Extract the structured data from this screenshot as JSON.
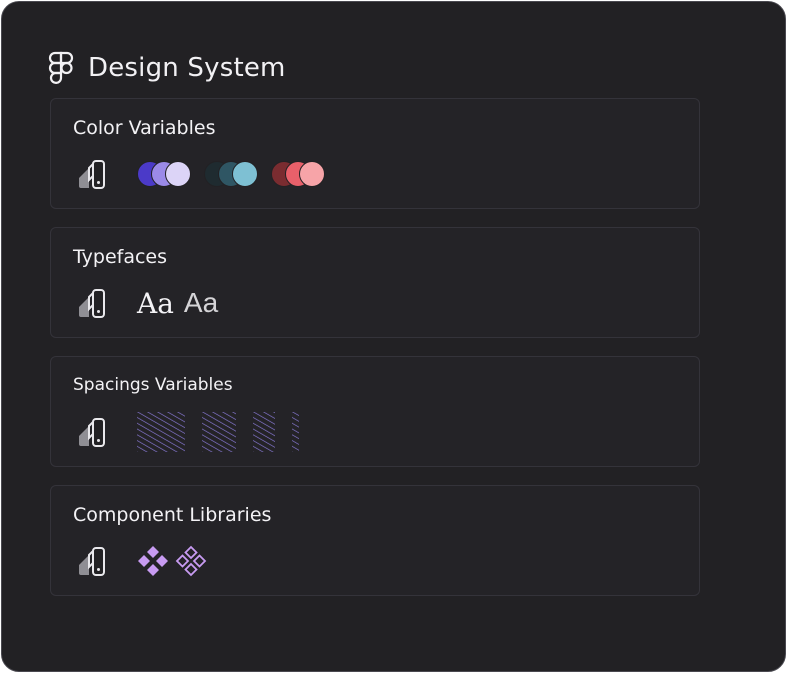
{
  "header": {
    "title": "Design System",
    "logo_icon": "figma-logo-icon"
  },
  "cards": [
    {
      "title": "Color Variables",
      "icon": "swatchbook-icon",
      "palettes": [
        [
          "#4b3ac8",
          "#9b8ae8",
          "#dcd4f7"
        ],
        [
          "#1f2b30",
          "#2f5664",
          "#7ec0d3"
        ],
        [
          "#7a2c30",
          "#e8606a",
          "#f7a4a8"
        ]
      ]
    },
    {
      "title": "Typefaces",
      "icon": "swatchbook-icon",
      "samples": [
        "Aa",
        "Aa"
      ]
    },
    {
      "title": "Spacings Variables",
      "icon": "swatchbook-icon",
      "spacing_color": "#8a7ad8"
    },
    {
      "title": "Component Libraries",
      "icon": "swatchbook-icon",
      "component_icons": [
        "component-filled-icon",
        "component-outline-icon"
      ],
      "component_color": "#c89bf2"
    }
  ],
  "colors": {
    "panel_bg": "#222124",
    "card_border": "#34333a",
    "text": "#f2f1f4"
  }
}
